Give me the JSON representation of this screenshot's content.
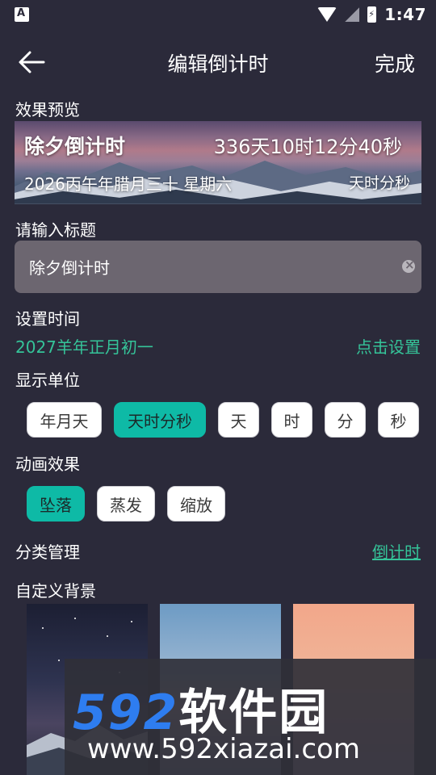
{
  "status_bar": {
    "time": "1:47"
  },
  "header": {
    "title": "编辑倒计时",
    "done_label": "完成"
  },
  "preview": {
    "section_label": "效果预览",
    "event_title": "除夕倒计时",
    "countdown": "336天10时12分40秒",
    "date_text": "2026丙午年腊月三十 星期六",
    "unit_text": "天时分秒"
  },
  "title_input": {
    "section_label": "请输入标题",
    "value": "除夕倒计时"
  },
  "time_setting": {
    "section_label": "设置时间",
    "date_value": "2027羊年正月初一",
    "action_label": "点击设置"
  },
  "display_unit": {
    "section_label": "显示单位",
    "options": [
      "年月天",
      "天时分秒",
      "天",
      "时",
      "分",
      "秒"
    ],
    "selected": "天时分秒"
  },
  "animation": {
    "section_label": "动画效果",
    "options": [
      "坠落",
      "蒸发",
      "缩放"
    ],
    "selected": "坠落"
  },
  "category": {
    "section_label": "分类管理",
    "value": "倒计时"
  },
  "background": {
    "section_label": "自定义背景"
  },
  "watermark": {
    "brand": "592",
    "brand_cn": "软件园",
    "url": "www.592xiazai.com"
  },
  "colors": {
    "accent_green": "#35c499",
    "active_chip": "#0ebaa6",
    "background": "#2b2a3a"
  },
  "icons": {
    "back": "arrow-left-icon",
    "clear": "clear-circle-icon"
  }
}
